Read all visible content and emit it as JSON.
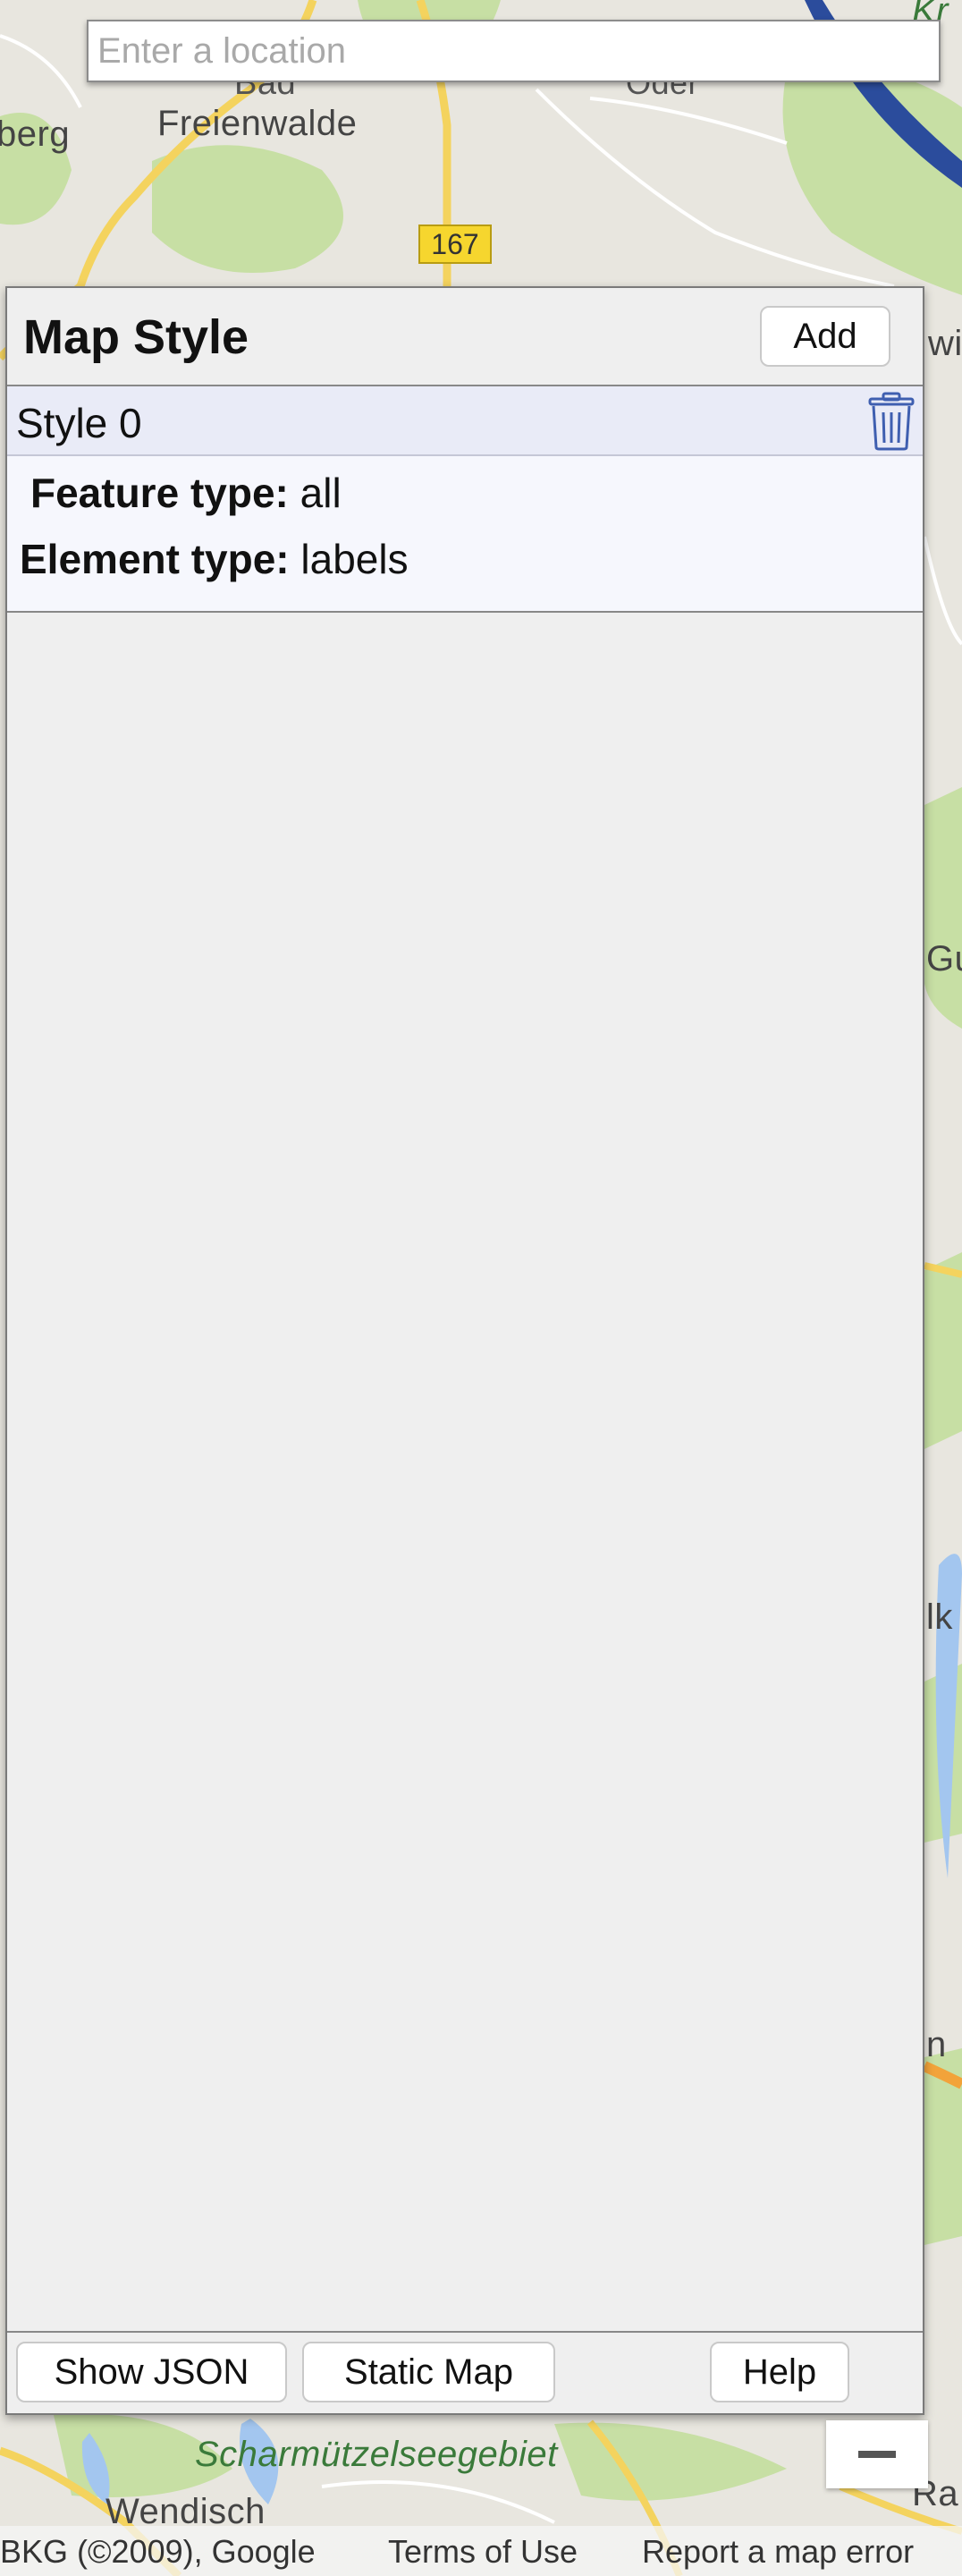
{
  "search": {
    "placeholder": "Enter a location"
  },
  "map_labels": {
    "bad_partial": "Bad",
    "freienwalde": "Freienwalde",
    "berg_partial": "berg",
    "road_number": "167",
    "scharmuetzel": "Scharmützelseegebiet",
    "wendisch": "Wendisch",
    "kr_partial": "Kr",
    "oder_partial": "Oder",
    "wi_partial": "wi",
    "gu_partial": "Gu",
    "ik_partial": "lk",
    "n_partial": "n",
    "ra_partial": "Ra"
  },
  "panel": {
    "title": "Map Style",
    "add_label": "Add",
    "styles": [
      {
        "name": "Style 0",
        "feature_type_label": "Feature type:",
        "feature_type": "all",
        "element_type_label": "Element type:",
        "element_type": "labels"
      }
    ],
    "footer": {
      "show_json": "Show JSON",
      "static_map": "Static Map",
      "help": "Help"
    }
  },
  "attribution": {
    "data": "BKG (©2009), Google",
    "terms": "Terms of Use",
    "report": "Report a map error"
  },
  "colors": {
    "panel_bg": "#efefef",
    "style_row_bg": "#e9ebf7",
    "trash_icon": "#3f5fb0",
    "road_yellow": "#f6d62e",
    "park_green": "#c7dfa4",
    "water_blue": "#a3c6ef"
  }
}
